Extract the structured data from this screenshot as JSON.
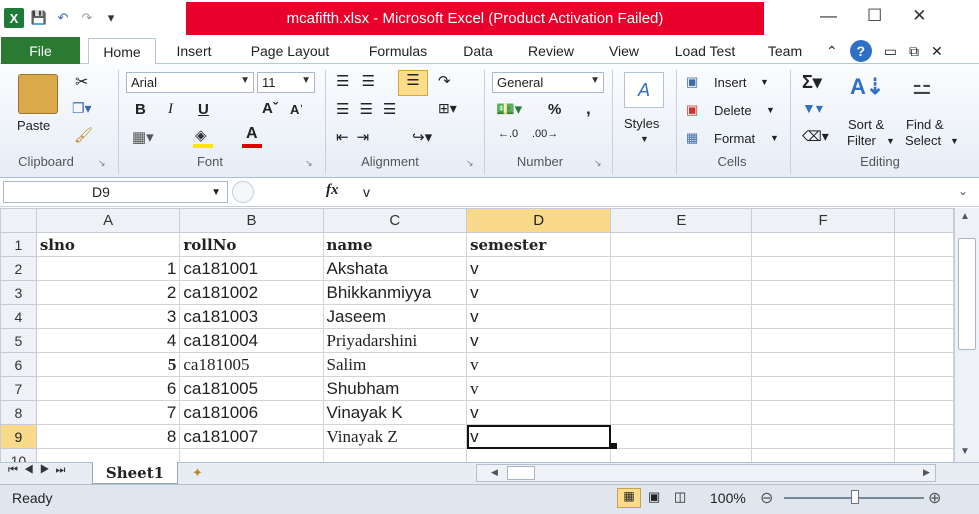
{
  "title": "mcafifth.xlsx - Microsoft Excel (Product Activation Failed)",
  "tabs": {
    "file": "File",
    "home": "Home",
    "insert": "Insert",
    "page_layout": "Page Layout",
    "formulas": "Formulas",
    "data": "Data",
    "review": "Review",
    "view": "View",
    "load_test": "Load Test",
    "team": "Team"
  },
  "ribbon": {
    "clipboard": {
      "paste": "Paste",
      "label": "Clipboard"
    },
    "font": {
      "name": "Arial",
      "size": "11",
      "label": "Font",
      "bold": "B",
      "italic": "I",
      "underline": "U"
    },
    "alignment": {
      "label": "Alignment"
    },
    "number": {
      "format": "General",
      "percent": "%",
      "comma": ",",
      "label": "Number"
    },
    "styles": {
      "label": "Styles"
    },
    "cells": {
      "insert": "Insert",
      "delete": "Delete",
      "format": "Format",
      "label": "Cells"
    },
    "editing": {
      "sort": "Sort &",
      "filter": "Filter",
      "find": "Find &",
      "select": "Select",
      "label": "Editing"
    }
  },
  "formula_bar": {
    "name_box": "D9",
    "fx": "fx",
    "content": "v"
  },
  "columns": [
    "A",
    "B",
    "C",
    "D",
    "E",
    "F"
  ],
  "rows": [
    {
      "n": "1",
      "a": "slno",
      "b": "rollNo",
      "c": "name",
      "d": "semester"
    },
    {
      "n": "2",
      "a": "1",
      "b": "ca181001",
      "c": "Akshata",
      "d": "v"
    },
    {
      "n": "3",
      "a": "2",
      "b": "ca181002",
      "c": "Bhikkanmiyya",
      "d": "v"
    },
    {
      "n": "4",
      "a": "3",
      "b": "ca181003",
      "c": "Jaseem",
      "d": "v"
    },
    {
      "n": "5",
      "a": "4",
      "b": "ca181004",
      "c": "Priyadarshini",
      "d": "v"
    },
    {
      "n": "6",
      "a": "5",
      "b": "ca181005",
      "c": "Salim",
      "d": "v"
    },
    {
      "n": "7",
      "a": "6",
      "b": "ca181005",
      "c": "Shubham",
      "d": "v"
    },
    {
      "n": "8",
      "a": "7",
      "b": "ca181006",
      "c": "Vinayak K",
      "d": "v"
    },
    {
      "n": "9",
      "a": "8",
      "b": "ca181007",
      "c": "Vinayak Z",
      "d": "v"
    },
    {
      "n": "10",
      "a": "",
      "b": "",
      "c": "",
      "d": ""
    }
  ],
  "sheet_tab": "Sheet1",
  "status": {
    "ready": "Ready",
    "zoom": "100%"
  },
  "colors": {
    "title_bg": "#e8002b",
    "file_tab": "#2a7a33",
    "selected_header": "#f9d98a"
  }
}
